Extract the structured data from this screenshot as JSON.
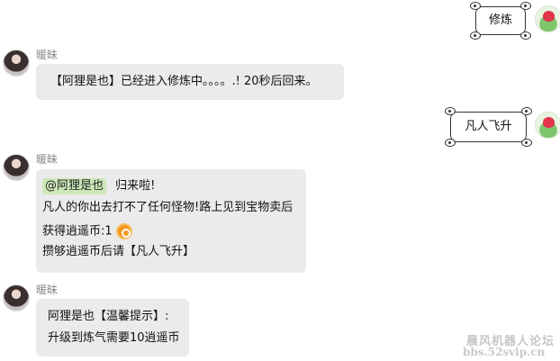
{
  "messages": {
    "m1_out": {
      "text": "修炼"
    },
    "m2_in": {
      "sender": "暖昧",
      "text": "【阿狸是也】已经进入修炼中。。。。.! 20秒后回来。"
    },
    "m3_out": {
      "text": "凡人飞升"
    },
    "m4_in": {
      "sender": "暖昧",
      "mention": "@阿狸是也",
      "line1_rest": "归来啦!",
      "line2": "凡人的你出去打不了任何怪物!路上见到宝物卖后",
      "line3": "获得逍遥币:1",
      "line4": "攒够逍遥币后请【凡人飞升】",
      "coin_icon": "coin-icon"
    },
    "m5_in": {
      "sender": "暖昧",
      "line1": "阿狸是也【温馨提示】:",
      "line2": "升级到炼气需要10逍遥币"
    }
  },
  "watermark": {
    "name": "晨风机器人论坛",
    "url": "bbs.52svip.cn"
  },
  "colors": {
    "bubble_incoming": "#ebebeb",
    "mention_highlight": "#cde8b8",
    "coin": "#f39a1e"
  }
}
